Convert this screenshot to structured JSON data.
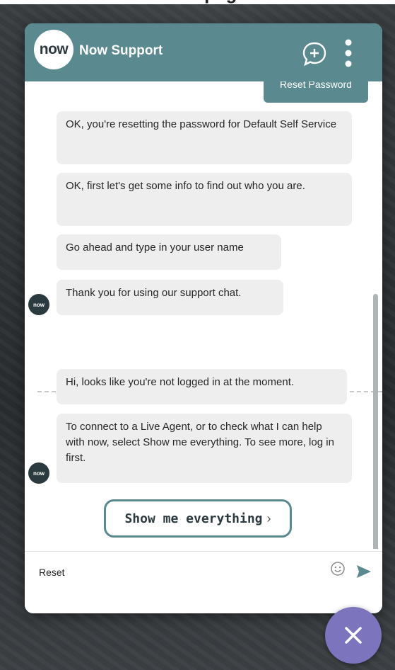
{
  "page": {
    "heading_fragment": "page"
  },
  "header": {
    "logo_text": "now",
    "title": "Now Support",
    "new_chat_icon": "chat-plus-icon",
    "more_icon": "more-vertical-icon",
    "color": "#5a8a8f"
  },
  "messages": {
    "user_reply": "Reset Password",
    "avatar_text": "now",
    "bot": [
      "OK, you're resetting the password for Default Self Service",
      "OK, first let's get some info to find out who you are.",
      "Go ahead and type in your user name",
      "Thank you for using our support chat.",
      "Hi, looks like you're not logged in at the moment.",
      "To connect to a Live Agent, or to check what I can help with now, select Show me everything. To see more, log in first."
    ],
    "action_button": "Show me everything",
    "action_chevron": "›"
  },
  "composer": {
    "value": "Reset",
    "emoji_icon": "emoji-icon",
    "send_icon": "send-icon"
  },
  "fab": {
    "icon": "close-icon",
    "color": "#7c74bd"
  }
}
